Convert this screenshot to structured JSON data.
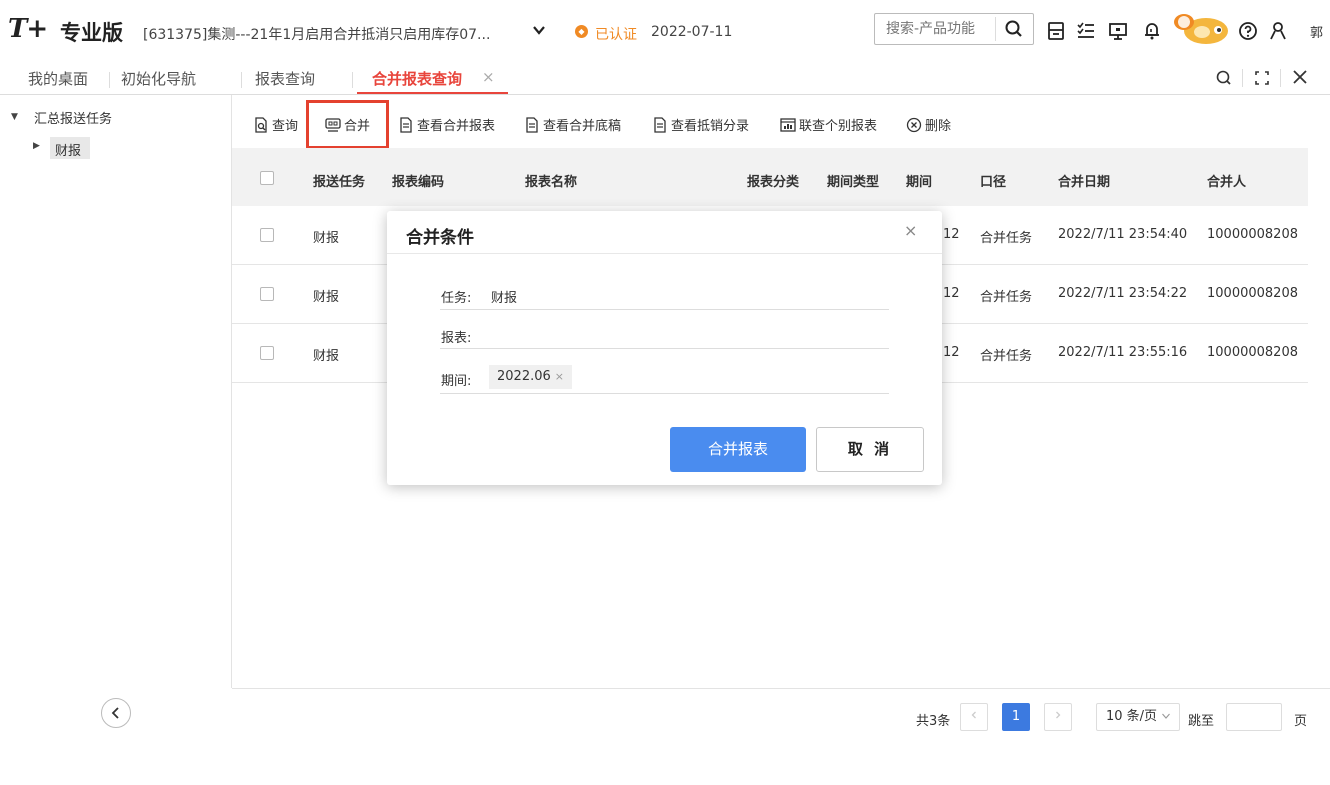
{
  "header": {
    "logo": "T+",
    "edition": "专业版",
    "account": "[631375]集测---21年1月启用合并抵消只启用库存07...",
    "certified": "已认证",
    "date": "2022-07-11",
    "search_placeholder": "搜索-产品功能",
    "user": "郭"
  },
  "tabs": [
    {
      "label": "我的桌面"
    },
    {
      "label": "初始化导航"
    },
    {
      "label": "报表查询"
    },
    {
      "label": "合并报表查询"
    }
  ],
  "tab_close": "×",
  "sidebar": {
    "root": "汇总报送任务",
    "child": "财报"
  },
  "toolbar": [
    {
      "label": "查询"
    },
    {
      "label": "合并"
    },
    {
      "label": "查看合并报表"
    },
    {
      "label": "查看合并底稿"
    },
    {
      "label": "查看抵销分录"
    },
    {
      "label": "联查个别报表"
    },
    {
      "label": "删除"
    }
  ],
  "table": {
    "columns": [
      "报送任务",
      "报表编码",
      "报表名称",
      "报表分类",
      "期间类型",
      "期间",
      "口径",
      "合并日期",
      "合并人"
    ],
    "rows": [
      {
        "task": "财报",
        "period_tail": "12",
        "scope": "合并任务",
        "date": "2022/7/11 23:54:40",
        "user": "10000008208"
      },
      {
        "task": "财报",
        "period_tail": "12",
        "scope": "合并任务",
        "date": "2022/7/11 23:54:22",
        "user": "10000008208"
      },
      {
        "task": "财报",
        "period_tail": "12",
        "scope": "合并任务",
        "date": "2022/7/11 23:55:16",
        "user": "10000008208"
      }
    ]
  },
  "dialog": {
    "title": "合并条件",
    "close": "×",
    "task_label": "任务:",
    "task_value": "财报",
    "report_label": "报表:",
    "period_label": "期间:",
    "period_tag": "2022.06",
    "tag_remove": "×",
    "confirm": "合并报表",
    "cancel": "取 消"
  },
  "pagination": {
    "total": "共3条",
    "current": "1",
    "page_size": "10 条/页",
    "jump_label": "跳至",
    "page_suffix": "页"
  },
  "colors": {
    "accent_red": "#e8453c",
    "primary_blue": "#4a8cef",
    "cert_orange": "#f08a24",
    "highlight_box": "#e4412f"
  }
}
